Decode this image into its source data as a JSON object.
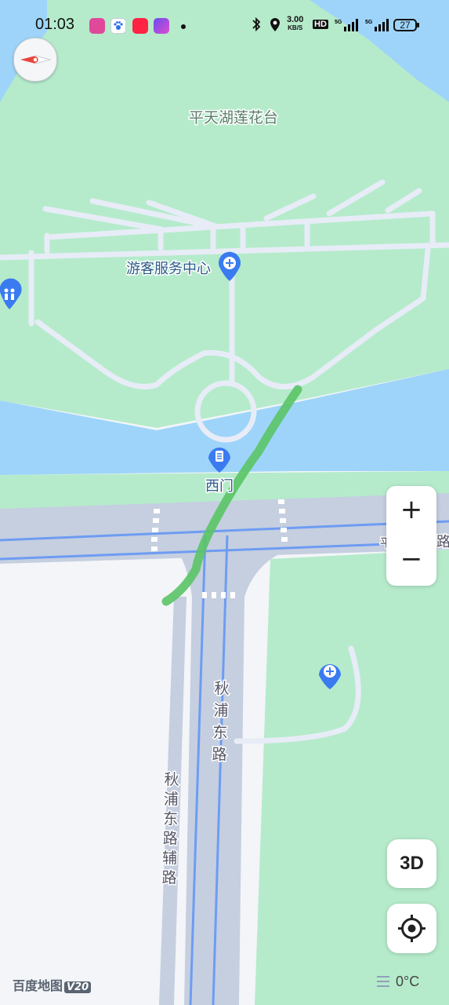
{
  "status_bar": {
    "time": "01:03",
    "net_speed_value": "3.00",
    "net_speed_unit": "KB/S",
    "hd_label": "HD",
    "battery_level": "27",
    "app_icons": [
      "vivo-app-icon",
      "baidu-paw-icon",
      "xiaohongshu-icon",
      "purple-app-icon"
    ]
  },
  "map": {
    "place_labels": {
      "pingtian_lake": "平天湖莲花台",
      "visitor_center": "游客服务中心",
      "west_gate": "西门"
    },
    "road_labels": {
      "qiupu_east_road": "秋浦东路",
      "qiupu_east_road_aux": "秋浦东路辅路",
      "right_road_fragment_1": "平",
      "right_road_fragment_2": "路"
    },
    "colors": {
      "park_green": "#b5ebcb",
      "water_blue": "#9ed4f9",
      "road_fill": "#c5cfe0",
      "road_blue_line": "#6e9cf2",
      "path_white": "#e7ecf7",
      "track_green": "#5ac466"
    }
  },
  "controls": {
    "zoom_in": "+",
    "zoom_out": "−",
    "three_d": "3D"
  },
  "footer": {
    "logo_text": "百度地图",
    "logo_version": "V20",
    "weather": "0°C"
  }
}
